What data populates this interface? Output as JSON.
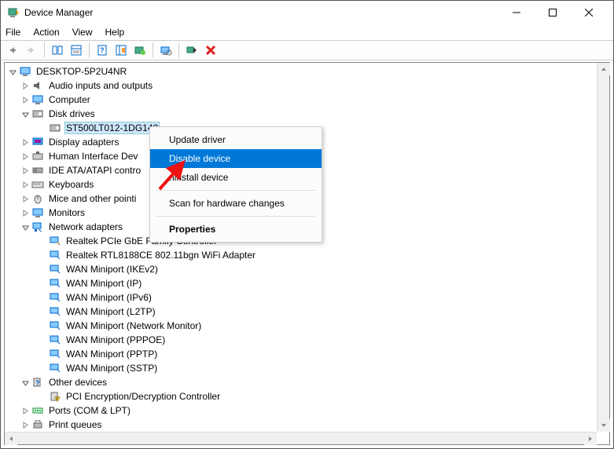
{
  "window": {
    "title": "Device Manager"
  },
  "menu": {
    "file": "File",
    "action": "Action",
    "view": "View",
    "help": "Help"
  },
  "tree": {
    "root": "DESKTOP-5P2U4NR",
    "audio": "Audio inputs and outputs",
    "computer": "Computer",
    "diskdrives": "Disk drives",
    "disk1": "ST500LT012-1DG142",
    "display": "Display adapters",
    "hid": "Human Interface Dev",
    "ide": "IDE ATA/ATAPI contro",
    "keyboards": "Keyboards",
    "mice": "Mice and other pointi",
    "monitors": "Monitors",
    "netadapters": "Network adapters",
    "net1": "Realtek PCIe GbE Family Controller",
    "net2": "Realtek RTL8188CE 802.11bgn WiFi Adapter",
    "net3": "WAN Miniport (IKEv2)",
    "net4": "WAN Miniport (IP)",
    "net5": "WAN Miniport (IPv6)",
    "net6": "WAN Miniport (L2TP)",
    "net7": "WAN Miniport (Network Monitor)",
    "net8": "WAN Miniport (PPPOE)",
    "net9": "WAN Miniport (PPTP)",
    "net10": "WAN Miniport (SSTP)",
    "other": "Other devices",
    "other1": "PCI Encryption/Decryption Controller",
    "ports": "Ports (COM & LPT)",
    "printq": "Print queues"
  },
  "context": {
    "update": "Update driver",
    "disable": "Disable device",
    "uninstall": "ninstall device",
    "scan": "Scan for hardware changes",
    "properties": "Properties"
  }
}
